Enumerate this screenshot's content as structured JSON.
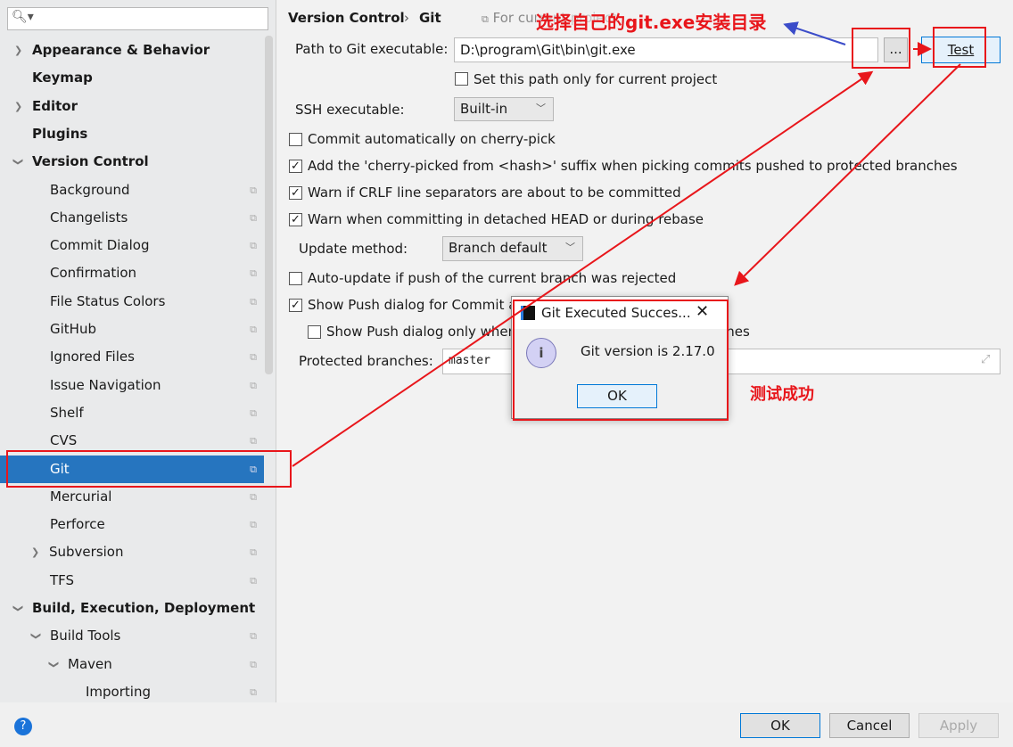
{
  "sidebar": {
    "search_placeholder": "",
    "items": [
      {
        "label": "Appearance & Behavior"
      },
      {
        "label": "Keymap"
      },
      {
        "label": "Editor"
      },
      {
        "label": "Plugins"
      },
      {
        "label": "Version Control"
      },
      {
        "label": "Background"
      },
      {
        "label": "Changelists"
      },
      {
        "label": "Commit Dialog"
      },
      {
        "label": "Confirmation"
      },
      {
        "label": "File Status Colors"
      },
      {
        "label": "GitHub"
      },
      {
        "label": "Ignored Files"
      },
      {
        "label": "Issue Navigation"
      },
      {
        "label": "Shelf"
      },
      {
        "label": "CVS"
      },
      {
        "label": "Git"
      },
      {
        "label": "Mercurial"
      },
      {
        "label": "Perforce"
      },
      {
        "label": "Subversion"
      },
      {
        "label": "TFS"
      },
      {
        "label": "Build, Execution, Deployment"
      },
      {
        "label": "Build Tools"
      },
      {
        "label": "Maven"
      },
      {
        "label": "Importing"
      }
    ]
  },
  "breadcrumb": {
    "parent": "Version Control",
    "sep": "›",
    "current": "Git",
    "scope": "For current project"
  },
  "git": {
    "path_label": "Path to Git executable:",
    "path_value": "D:\\program\\Git\\bin\\git.exe",
    "browse": "...",
    "test": "Test",
    "path_only_project": "Set this path only for current project",
    "ssh_label": "SSH executable:",
    "ssh_value": "Built-in",
    "opts": [
      {
        "label": "Commit automatically on cherry-pick",
        "checked": false
      },
      {
        "label": "Add the 'cherry-picked from <hash>' suffix when picking commits pushed to protected branches",
        "checked": true
      },
      {
        "label": "Warn if CRLF line separators are about to be committed",
        "checked": true
      },
      {
        "label": "Warn when committing in detached HEAD or during rebase",
        "checked": true
      }
    ],
    "update_label": "Update method:",
    "update_value": "Branch default",
    "auto_update": "Auto-update if push of the current branch was rejected",
    "show_push": "Show Push dialog for Commit and Push",
    "show_push_only": "Show Push dialog only when committing to protected branches",
    "protected_label": "Protected branches:",
    "protected_value": "master"
  },
  "dialog": {
    "title": "Git Executed Successfully",
    "message": "Git version is 2.17.0",
    "ok": "OK"
  },
  "footer": {
    "ok": "OK",
    "cancel": "Cancel",
    "apply": "Apply",
    "help": "?"
  },
  "annotations": {
    "select_dir": "选择自己的git.exe安装目录",
    "success": "测试成功",
    "color": "#e8161b",
    "blue": "#3b4cc9"
  }
}
